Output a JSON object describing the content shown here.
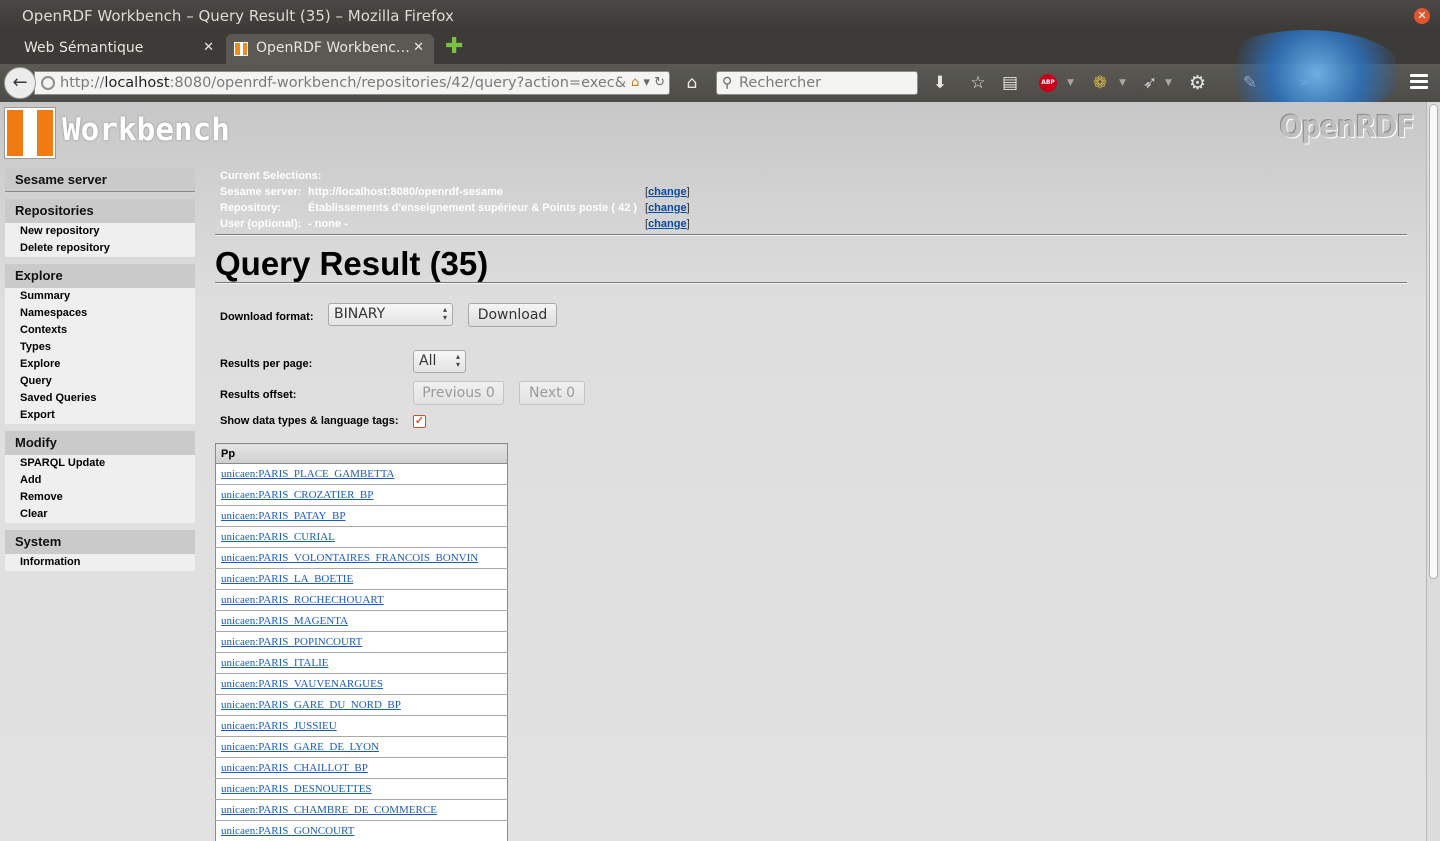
{
  "window": {
    "title": "OpenRDF Workbench – Query Result (35) – Mozilla Firefox"
  },
  "tabs": [
    {
      "label": "Web Sémantique"
    },
    {
      "label": "OpenRDF Workbenc…"
    }
  ],
  "navbar": {
    "url_prefix": "http://",
    "url_host": "localhost",
    "url_rest": ":8080/openrdf-workbench/repositories/42/query?action=exec&qu",
    "search_placeholder": "Rechercher"
  },
  "brand": {
    "wordmark": "Workbench",
    "product": "OpenRDF"
  },
  "sidebar": {
    "server": "Sesame server",
    "groups": [
      {
        "title": "Repositories",
        "items": [
          "New repository",
          "Delete repository"
        ]
      },
      {
        "title": "Explore",
        "items": [
          "Summary",
          "Namespaces",
          "Contexts",
          "Types",
          "Explore",
          "Query",
          "Saved Queries",
          "Export"
        ]
      },
      {
        "title": "Modify",
        "items": [
          "SPARQL Update",
          "Add",
          "Remove",
          "Clear"
        ]
      },
      {
        "title": "System",
        "items": [
          "Information"
        ]
      }
    ]
  },
  "selections": {
    "heading": "Current Selections:",
    "server_label": "Sesame server:",
    "server_value": "http://localhost:8080/openrdf-sesame",
    "repository_label": "Repository:",
    "repository_value": "Établissements d'enseignement supérieur & Points poste ( 42 )",
    "user_label": "User (optional):",
    "user_value": "- none -",
    "change_label": "change"
  },
  "main": {
    "title": "Query Result (35)",
    "download_label": "Download format:",
    "download_format": "BINARY",
    "download_button": "Download",
    "per_page_label": "Results per page:",
    "per_page_value": "All",
    "offset_label": "Results offset:",
    "previous_button": "Previous 0",
    "next_button": "Next 0",
    "datatypes_label": "Show data types & language tags:",
    "datatypes_checked": true
  },
  "results": {
    "column": "Pp",
    "rows": [
      "unicaen:PARIS_PLACE_GAMBETTA",
      "unicaen:PARIS_CROZATIER_BP",
      "unicaen:PARIS_PATAY_BP",
      "unicaen:PARIS_CURIAL",
      "unicaen:PARIS_VOLONTAIRES_FRANCOIS_BONVIN",
      "unicaen:PARIS_LA_BOETIE",
      "unicaen:PARIS_ROCHECHOUART",
      "unicaen:PARIS_MAGENTA",
      "unicaen:PARIS_POPINCOURT",
      "unicaen:PARIS_ITALIE",
      "unicaen:PARIS_VAUVENARGUES",
      "unicaen:PARIS_GARE_DU_NORD_BP",
      "unicaen:PARIS_JUSSIEU",
      "unicaen:PARIS_GARE_DE_LYON",
      "unicaen:PARIS_CHAILLOT_BP",
      "unicaen:PARIS_DESNOUETTES",
      "unicaen:PARIS_CHAMBRE_DE_COMMERCE",
      "unicaen:PARIS_GONCOURT"
    ]
  },
  "colors": {
    "accent": "#f07b12",
    "link": "#1a5bbf",
    "titlebar": "#3c3b37"
  }
}
